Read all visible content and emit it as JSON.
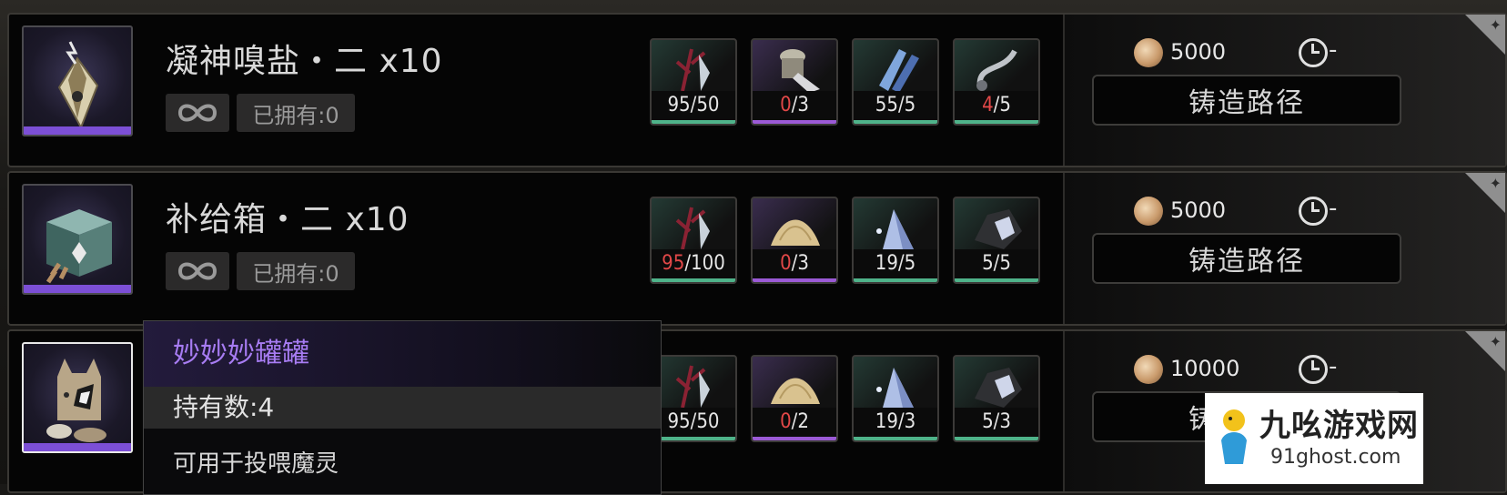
{
  "rows": [
    {
      "title": "凝神嗅盐・二 x10",
      "owned": "已拥有:0",
      "materials": [
        {
          "icon": "red-crystal-branch-icon",
          "have": "95",
          "need": "/50",
          "have_red": false
        },
        {
          "icon": "bone-fragment-icon",
          "have": "0",
          "need": "/3",
          "have_red": true
        },
        {
          "icon": "blue-crystal-icon",
          "have": "55",
          "need": "/5",
          "have_red": false
        },
        {
          "icon": "silver-hook-icon",
          "have": "4",
          "need": "/5",
          "have_red": true
        }
      ],
      "cost": "5000",
      "time": "-",
      "forge_label": "铸造路径"
    },
    {
      "title": "补给箱・二 x10",
      "owned": "已拥有:0",
      "materials": [
        {
          "icon": "red-crystal-branch-icon",
          "have": "95",
          "need": "/100",
          "have_red": true
        },
        {
          "icon": "sand-pile-icon",
          "have": "0",
          "need": "/3",
          "have_red": true
        },
        {
          "icon": "ice-crystal-icon",
          "have": "19",
          "need": "/5",
          "have_red": false
        },
        {
          "icon": "dark-ore-icon",
          "have": "5",
          "need": "/5",
          "have_red": false
        }
      ],
      "cost": "5000",
      "time": "-",
      "forge_label": "铸造路径"
    },
    {
      "materials": [
        {
          "icon": "red-crystal-branch-icon",
          "have": "95",
          "need": "/50",
          "have_red": false
        },
        {
          "icon": "sand-pile-icon",
          "have": "0",
          "need": "/2",
          "have_red": true
        },
        {
          "icon": "ice-crystal-icon",
          "have": "19",
          "need": "/3",
          "have_red": false
        },
        {
          "icon": "dark-ore-icon",
          "have": "5",
          "need": "/3",
          "have_red": false
        }
      ],
      "cost": "10000",
      "time": "-",
      "forge_label": "铸造路径"
    }
  ],
  "tooltip": {
    "name": "妙妙妙罐罐",
    "hold": "持有数:4",
    "desc": "可用于投喂魔灵"
  },
  "watermark": {
    "name": "九吆游戏网",
    "url": "91ghost.com"
  },
  "colors": {
    "accent_purple": "#7c4fd6",
    "shortage_red": "#e24848",
    "ok_green": "#4fb38a",
    "tooltip_name": "#a77cf2"
  }
}
